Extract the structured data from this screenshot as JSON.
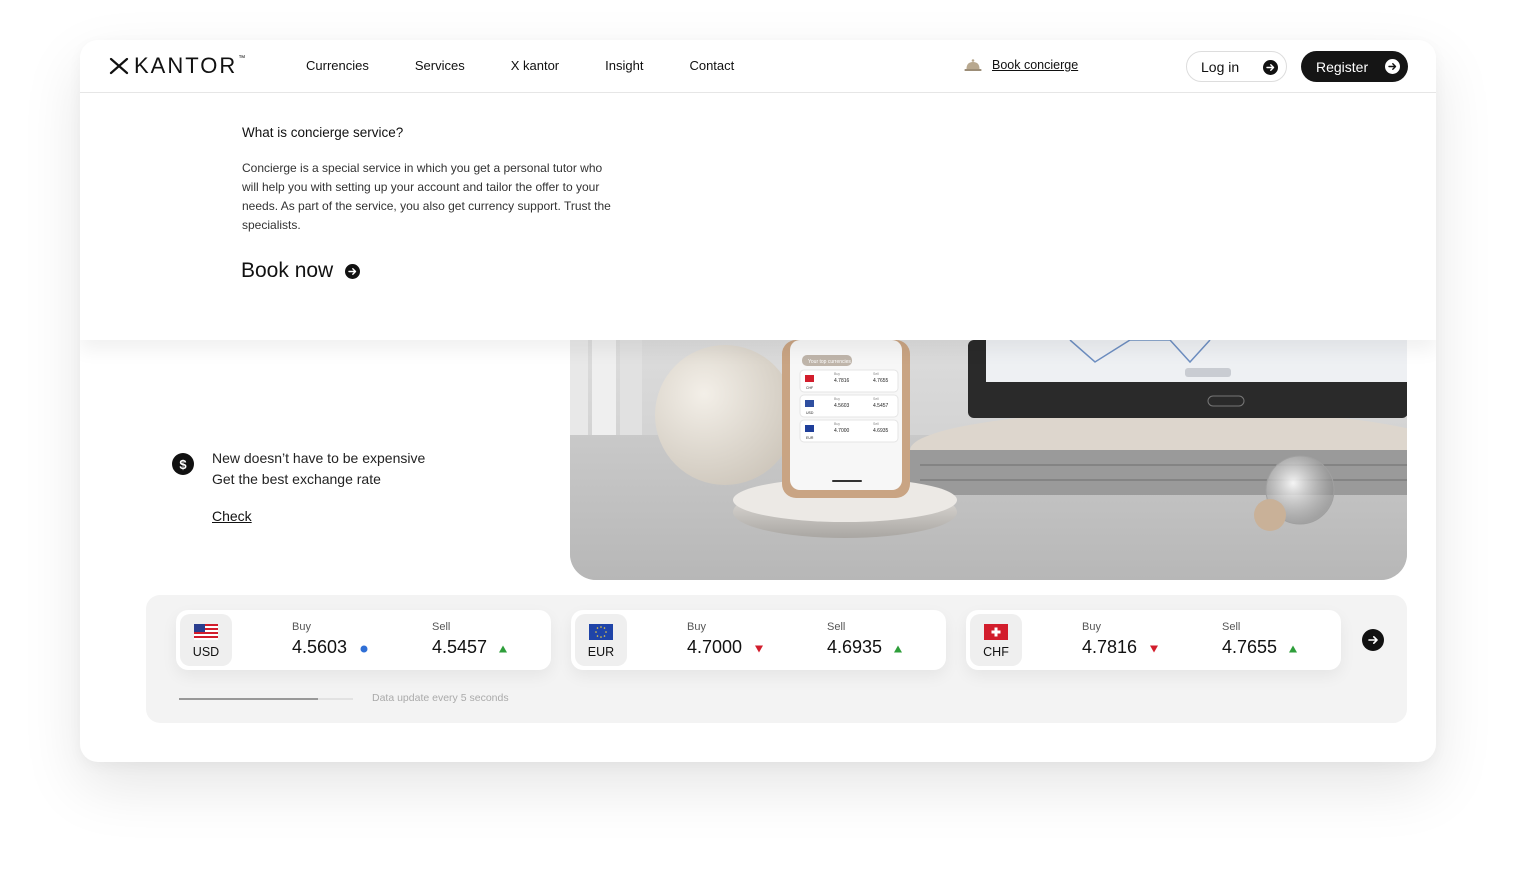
{
  "brand": {
    "name": "KANTOR",
    "tm": "™"
  },
  "nav": [
    {
      "label": "Currencies"
    },
    {
      "label": "Services"
    },
    {
      "label": "X kantor"
    },
    {
      "label": "Insight"
    },
    {
      "label": "Contact"
    }
  ],
  "header": {
    "concierge_label": "Book concierge",
    "login_label": "Log in",
    "register_label": "Register"
  },
  "concierge": {
    "title": "What is concierge service?",
    "body": "Concierge is a special service in which you get a personal tutor who will help you with setting up your account and tailor the offer to your needs. As part of the service, you also get currency support. Trust the specialists.",
    "cta": "Book now"
  },
  "promo": {
    "line1": "New doesn’t have to be expensive",
    "line2": "Get the best exchange rate",
    "link": "Check"
  },
  "phone_widget": {
    "header": "Your top currencies",
    "rows": [
      {
        "code": "CHF",
        "buy_label": "Buy",
        "buy": "4.7816",
        "sell_label": "Sell",
        "sell": "4.7655"
      },
      {
        "code": "USD",
        "buy_label": "Buy",
        "buy": "4.5603",
        "sell_label": "Sell",
        "sell": "4.5457"
      },
      {
        "code": "EUR",
        "buy_label": "Buy",
        "buy": "4.7000",
        "sell_label": "Sell",
        "sell": "4.6935"
      }
    ]
  },
  "rates": {
    "buy_label": "Buy",
    "sell_label": "Sell",
    "items": [
      {
        "code": "USD",
        "buy": "4.5603",
        "buy_trend": "neutral",
        "sell": "4.5457",
        "sell_trend": "up"
      },
      {
        "code": "EUR",
        "buy": "4.7000",
        "buy_trend": "down",
        "sell": "4.6935",
        "sell_trend": "up"
      },
      {
        "code": "CHF",
        "buy": "4.7816",
        "buy_trend": "down",
        "sell": "4.7655",
        "sell_trend": "up"
      }
    ],
    "update_text": "Data update every 5 seconds",
    "progress": 0.8
  },
  "colors": {
    "up": "#2e9e3a",
    "down": "#d21d2c",
    "neutral": "#2f6fd6",
    "dark": "#151515"
  },
  "icons": [
    "x-logo-icon",
    "bell-icon",
    "arrow-right-icon",
    "dollar-icon",
    "flag-us-icon",
    "flag-eu-icon",
    "flag-ch-icon"
  ]
}
